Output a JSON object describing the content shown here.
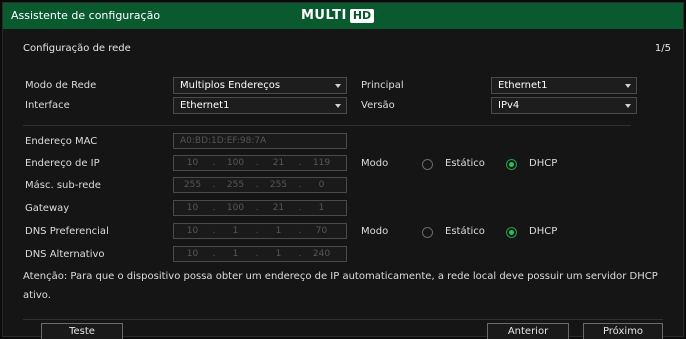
{
  "window": {
    "title": "Assistente de configuração",
    "logo_multi": "MULTI",
    "logo_hd": "HD"
  },
  "section": {
    "title": "Configuração de rede",
    "page_indicator": "1/5"
  },
  "network": {
    "mode_label": "Modo de Rede",
    "mode_value": "Multiplos Endereços",
    "principal_label": "Principal",
    "principal_value": "Ethernet1",
    "interface_label": "Interface",
    "interface_value": "Ethernet1",
    "version_label": "Versão",
    "version_value": "IPv4"
  },
  "addresses": {
    "mac_label": "Endereço MAC",
    "mac_value": "A0:BD:1D:EF:98:7A",
    "ip_label": "Endereço de IP",
    "ip": [
      "10",
      "100",
      "21",
      "119"
    ],
    "mask_label": "Másc. sub-rede",
    "mask": [
      "255",
      "255",
      "255",
      "0"
    ],
    "gateway_label": "Gateway",
    "gateway": [
      "10",
      "100",
      "21",
      "1"
    ],
    "dns1_label": "DNS Preferencial",
    "dns1": [
      "10",
      "1",
      "1",
      "70"
    ],
    "dns2_label": "DNS Alternativo",
    "dns2": [
      "10",
      "1",
      "1",
      "240"
    ]
  },
  "ip_mode": {
    "label": "Modo",
    "static": "Estático",
    "dhcp": "DHCP",
    "selected": "DHCP"
  },
  "dns_mode": {
    "label": "Modo",
    "static": "Estático",
    "dhcp": "DHCP",
    "selected": "DHCP"
  },
  "note": "Atenção: Para que o dispositivo possa obter um endereço de IP automaticamente, a rede local deve possuir um servidor DHCP ativo.",
  "buttons": {
    "test": "Teste",
    "previous": "Anterior",
    "next": "Próximo"
  },
  "colors": {
    "titlebar": "#0a5a30",
    "radio_selected": "#1fc45a"
  }
}
